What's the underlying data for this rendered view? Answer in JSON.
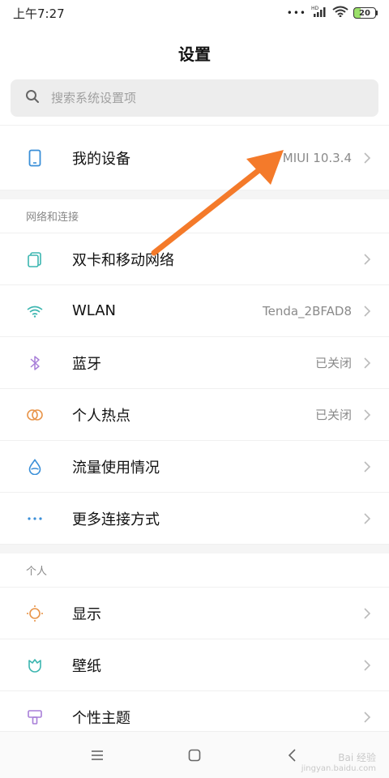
{
  "status_bar": {
    "time": "上午7:27",
    "network": "HD",
    "battery": "20"
  },
  "header": {
    "title": "设置"
  },
  "search": {
    "placeholder": "搜索系统设置项"
  },
  "device": {
    "label": "我的设备",
    "value": "MIUI 10.3.4"
  },
  "sections": [
    {
      "title": "网络和连接",
      "items": [
        {
          "label": "双卡和移动网络",
          "value": ""
        },
        {
          "label": "WLAN",
          "value": "Tenda_2BFAD8"
        },
        {
          "label": "蓝牙",
          "value": "已关闭"
        },
        {
          "label": "个人热点",
          "value": "已关闭"
        },
        {
          "label": "流量使用情况",
          "value": ""
        },
        {
          "label": "更多连接方式",
          "value": ""
        }
      ]
    },
    {
      "title": "个人",
      "items": [
        {
          "label": "显示",
          "value": ""
        },
        {
          "label": "壁纸",
          "value": ""
        },
        {
          "label": "个性主题",
          "value": ""
        }
      ]
    }
  ],
  "watermark": {
    "line1": "Bai 经验",
    "line2": "jingyan.baidu.com"
  },
  "colors": {
    "arrow": "#f47a2a",
    "icon_blue": "#3a8fd8",
    "icon_teal": "#3cb6b0",
    "icon_purple": "#a87fd8",
    "icon_orange": "#e8954a"
  }
}
